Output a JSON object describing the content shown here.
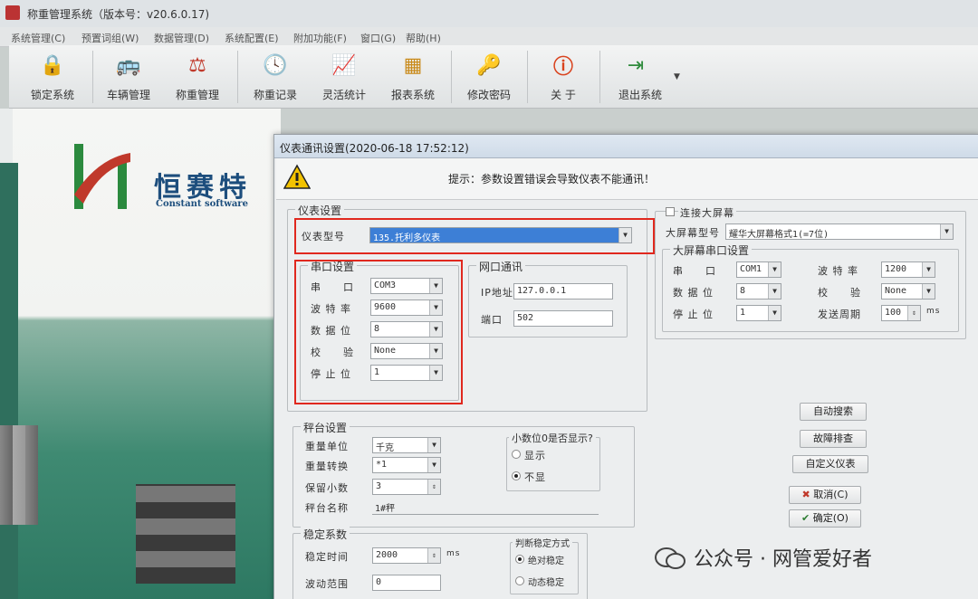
{
  "window": {
    "title": "称重管理系统（版本号：v20.6.0.17)"
  },
  "menu": [
    "系统管理(C)",
    "预置词组(W)",
    "数据管理(D)",
    "系统配置(E)",
    "附加功能(F)",
    "窗口(G)",
    "帮助(H)"
  ],
  "toolbar": [
    {
      "label": "锁定系统",
      "icon": "lock-icon",
      "glyph": "🔒"
    },
    {
      "label": "车辆管理",
      "icon": "bus-icon",
      "glyph": "🚌"
    },
    {
      "label": "称重管理",
      "icon": "scale-icon",
      "glyph": "⚖"
    },
    {
      "label": "称重记录",
      "icon": "clock-icon",
      "glyph": "🕓"
    },
    {
      "label": "灵活统计",
      "icon": "chart-icon",
      "glyph": "📈"
    },
    {
      "label": "报表系统",
      "icon": "report-icon",
      "glyph": "▦"
    },
    {
      "label": "修改密码",
      "icon": "key-icon",
      "glyph": "🔑"
    },
    {
      "label": "关  于",
      "icon": "info-icon",
      "glyph": "ⓘ"
    },
    {
      "label": "退出系统",
      "icon": "exit-icon",
      "glyph": "⇥"
    }
  ],
  "logo": {
    "cn": "恒赛特",
    "en": "Constant software"
  },
  "dialog": {
    "title": "仪表通讯设置(2020-06-18 17:52:12)",
    "warning": "提示：参数设置错误会导致仪表不能通讯！",
    "instrument": {
      "group": "仪表设置",
      "model_label": "仪表型号",
      "model_value": "135.托利多仪表"
    },
    "serial": {
      "group": "串口设置",
      "rows": [
        {
          "label": "串　　口",
          "value": "COM3"
        },
        {
          "label": "波 特 率",
          "value": "9600"
        },
        {
          "label": "数 据 位",
          "value": "8"
        },
        {
          "label": "校　　验",
          "value": "None"
        },
        {
          "label": "停 止 位",
          "value": "1"
        }
      ]
    },
    "network": {
      "group": "网口通讯",
      "ip_label": "IP地址",
      "ip_value": "127.0.0.1",
      "port_label": "端口",
      "port_value": "502"
    },
    "bigscreen": {
      "connect_label": "连接大屏幕",
      "model_label": "大屏幕型号",
      "model_value": "耀华大屏幕格式1(=7位)",
      "serial_group": "大屏幕串口设置",
      "port_label": "串　　口",
      "port_value": "COM1",
      "baud_label": "波 特 率",
      "baud_value": "1200",
      "data_label": "数 据 位",
      "data_value": "8",
      "parity_label": "校　　验",
      "parity_value": "None",
      "stop_label": "停 止 位",
      "stop_value": "1",
      "period_label": "发送周期",
      "period_value": "100",
      "period_unit": "ms"
    },
    "platform": {
      "group": "秤台设置",
      "unit_label": "重量单位",
      "unit_value": "千克",
      "conv_label": "重量转换",
      "conv_value": "*1",
      "dec_label": "保留小数",
      "dec_value": "3",
      "name_label": "秤台名称",
      "name_value": "1#秤",
      "zero_group": "小数位0是否显示?",
      "show": "显示",
      "hide": "不显"
    },
    "stable": {
      "group": "稳定系数",
      "time_label": "稳定时间",
      "time_value": "2000",
      "time_unit": "ms",
      "range_label": "波动范围",
      "range_value": "0",
      "judge_group": "判断稳定方式",
      "absolute": "绝对稳定",
      "dynamic": "动态稳定"
    },
    "buttons": {
      "auto_search": "自动搜索",
      "troubleshoot": "故障排查",
      "custom": "自定义仪表",
      "cancel": "取消(C)",
      "ok": "确定(O)"
    }
  },
  "watermark": "公众号 · 网管爱好者",
  "colors": {
    "highlight": "#e0281e",
    "selection": "#3d7fd6"
  }
}
